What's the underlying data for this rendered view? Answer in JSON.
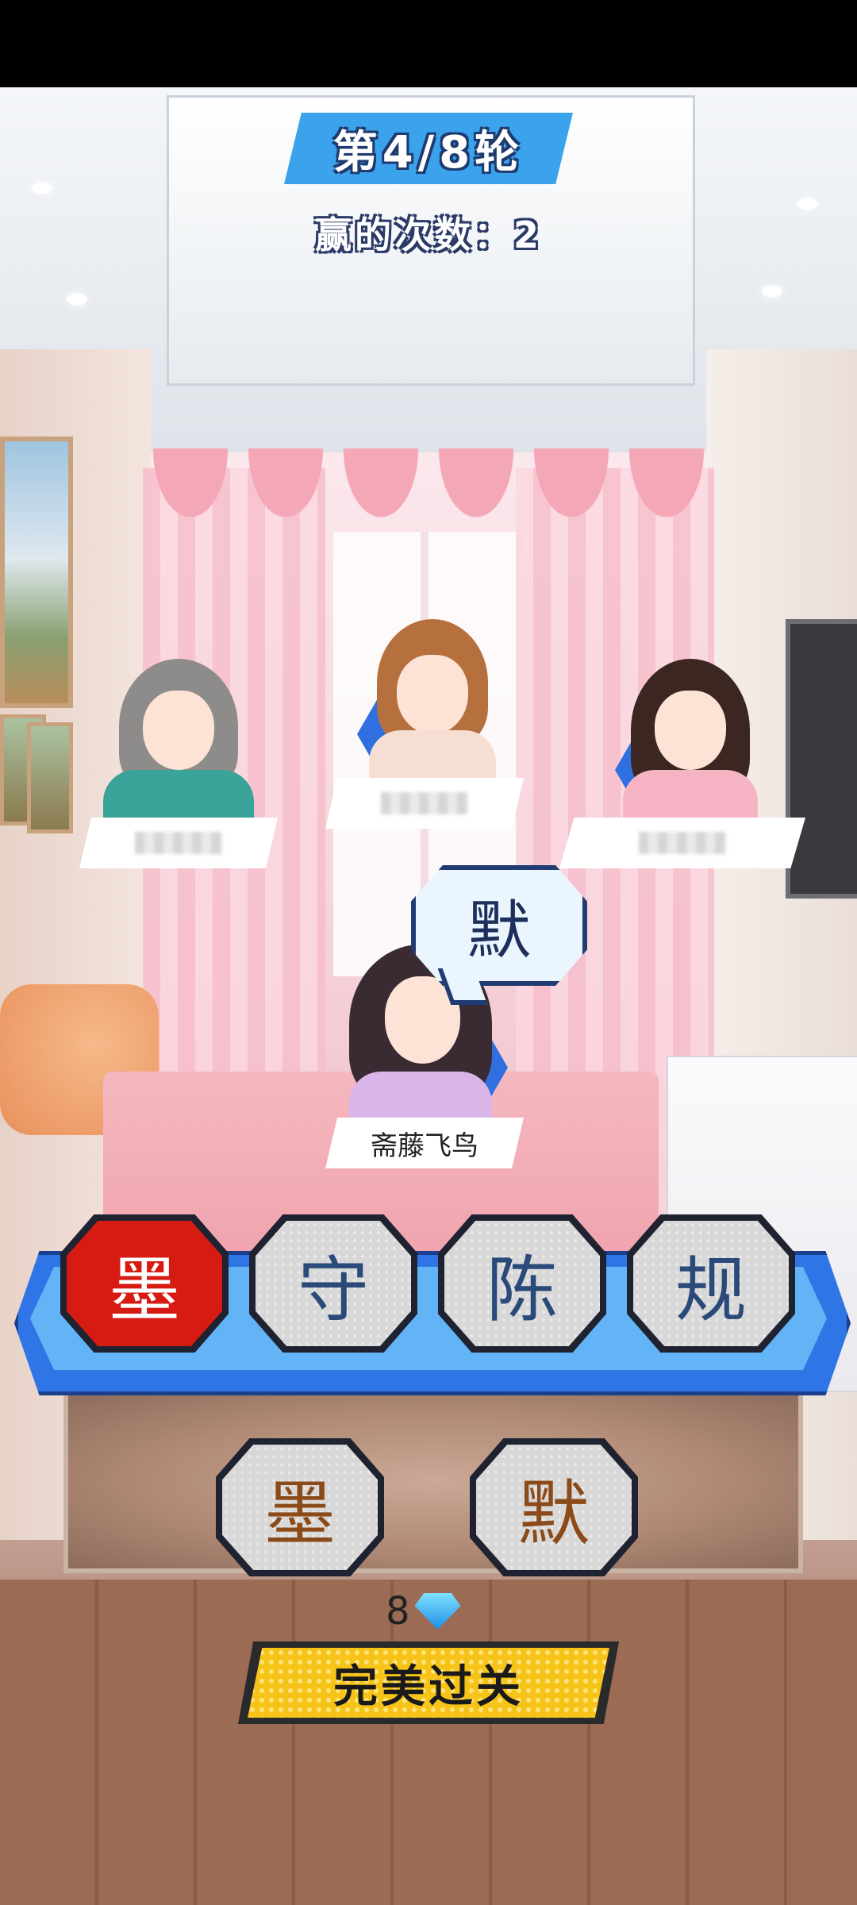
{
  "hud": {
    "round": "第4/8轮",
    "wins": "赢的次数：2"
  },
  "players": [
    {
      "name": ""
    },
    {
      "name": ""
    },
    {
      "name": ""
    },
    {
      "name": "斋藤飞鸟"
    }
  ],
  "speech": {
    "char": "默"
  },
  "tiles": [
    "墨",
    "守",
    "陈",
    "规"
  ],
  "answer": [
    "墨",
    "默"
  ],
  "reward": {
    "gems": "8"
  },
  "perfect_button": "完美过关",
  "colors": {
    "accent_blue": "#2f75e6",
    "selected_red": "#d51b12",
    "button_yellow": "#f6c418"
  }
}
